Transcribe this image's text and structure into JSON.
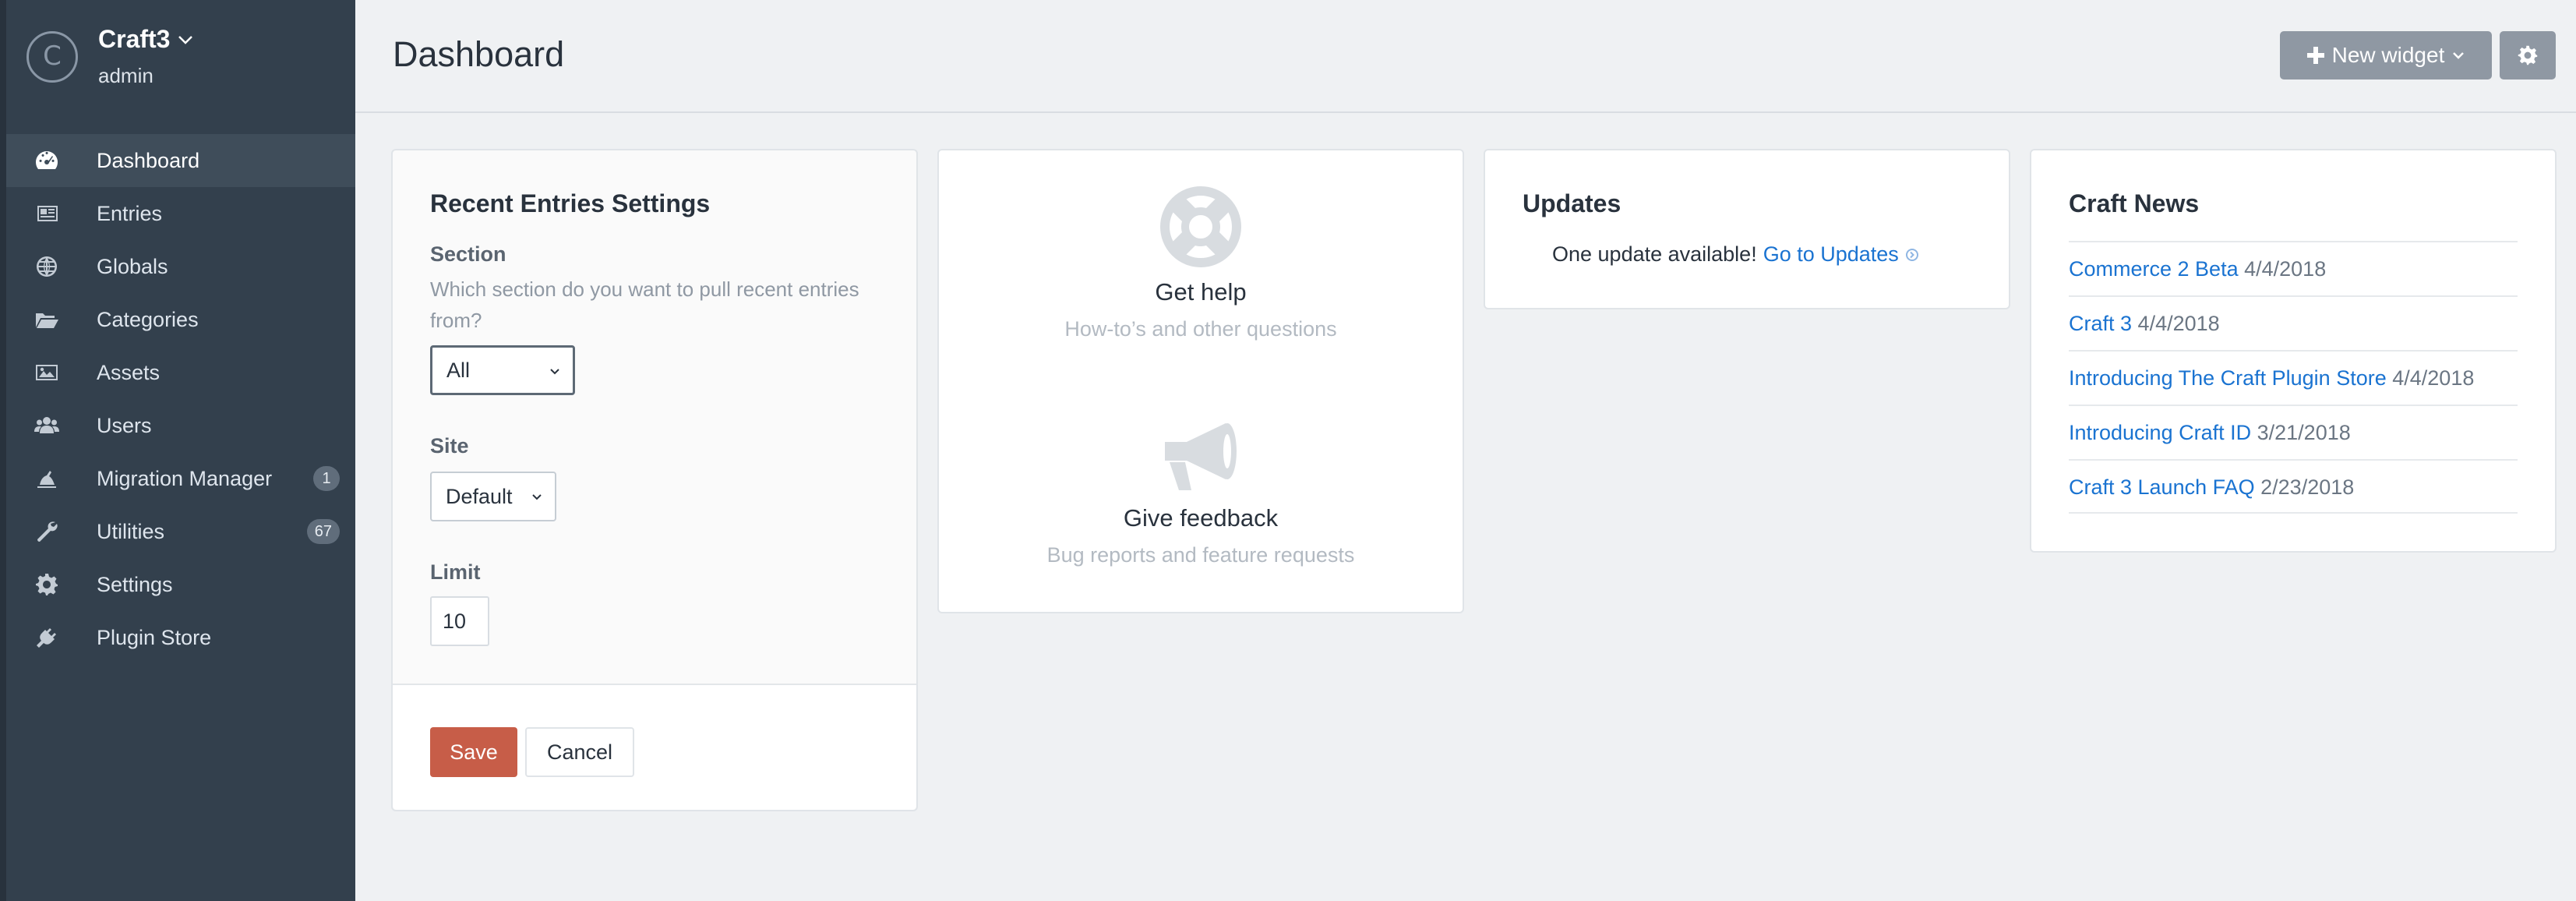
{
  "sidebar": {
    "site_logo_letter": "C",
    "site_name": "Craft3",
    "user_name": "admin",
    "items": [
      {
        "label": "Dashboard",
        "icon": "gauge-icon",
        "active": true,
        "badge": ""
      },
      {
        "label": "Entries",
        "icon": "newspaper-icon",
        "active": false,
        "badge": ""
      },
      {
        "label": "Globals",
        "icon": "globe-icon",
        "active": false,
        "badge": ""
      },
      {
        "label": "Categories",
        "icon": "folder-open-icon",
        "active": false,
        "badge": ""
      },
      {
        "label": "Assets",
        "icon": "image-icon",
        "active": false,
        "badge": ""
      },
      {
        "label": "Users",
        "icon": "users-icon",
        "active": false,
        "badge": ""
      },
      {
        "label": "Migration Manager",
        "icon": "migration-icon",
        "active": false,
        "badge": "1"
      },
      {
        "label": "Utilities",
        "icon": "wrench-icon",
        "active": false,
        "badge": "67"
      },
      {
        "label": "Settings",
        "icon": "gear-icon",
        "active": false,
        "badge": ""
      },
      {
        "label": "Plugin Store",
        "icon": "plug-icon",
        "active": false,
        "badge": ""
      }
    ]
  },
  "header": {
    "title": "Dashboard",
    "new_widget_label": "New widget"
  },
  "widgets": {
    "recent_entries_settings": {
      "title": "Recent Entries Settings",
      "section_label": "Section",
      "section_instructions": "Which section do you want to pull recent entries from?",
      "section_value": "All",
      "site_label": "Site",
      "site_value": "Default",
      "limit_label": "Limit",
      "limit_value": "10",
      "save_label": "Save",
      "cancel_label": "Cancel"
    },
    "help": {
      "get_help_title": "Get help",
      "get_help_sub": "How-to’s and other questions",
      "feedback_title": "Give feedback",
      "feedback_sub": "Bug reports and feature requests"
    },
    "updates": {
      "title": "Updates",
      "message": "One update available!",
      "link_label": "Go to Updates"
    },
    "news": {
      "title": "Craft News",
      "items": [
        {
          "title": "Commerce 2 Beta",
          "date": "4/4/2018"
        },
        {
          "title": "Craft 3",
          "date": "4/4/2018"
        },
        {
          "title": "Introducing The Craft Plugin Store",
          "date": "4/4/2018"
        },
        {
          "title": "Introducing Craft ID",
          "date": "3/21/2018"
        },
        {
          "title": "Craft 3 Launch FAQ",
          "date": "2/23/2018"
        }
      ]
    }
  },
  "colors": {
    "sidebar_bg": "#33404d",
    "link": "#1a73d1",
    "save_button": "#c75d48",
    "header_button": "#8f98a3"
  }
}
